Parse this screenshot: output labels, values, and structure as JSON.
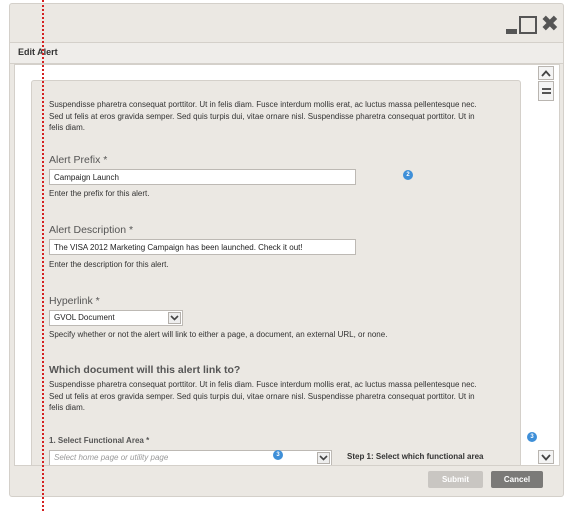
{
  "window": {
    "title": "Edit Alert",
    "controls": [
      "minimize-icon",
      "maximize-icon",
      "close-icon"
    ]
  },
  "form": {
    "intro": "Suspendisse pharetra consequat porttitor. Ut in felis diam. Fusce interdum mollis erat, ac luctus massa pellentesque nec. Sed ut felis at eros gravida semper. Sed quis turpis dui, vitae ornare nisl. Suspendisse pharetra consequat porttitor. Ut in felis diam.",
    "alert_prefix": {
      "label": "Alert Prefix *",
      "value": "Campaign Launch",
      "help": "Enter the prefix for this alert.",
      "badge": "2"
    },
    "alert_description": {
      "label": "Alert Description *",
      "value": "The VISA 2012 Marketing Campaign has been launched.  Check it out!",
      "help": "Enter the description for this alert."
    },
    "hyperlink": {
      "label": "Hyperlink *",
      "selected": "GVOL Document",
      "help": "Specify whether or not the alert will link to either a page, a document, an external URL, or none."
    },
    "document_section": {
      "heading": "Which document will this alert link to?",
      "description": "Suspendisse pharetra consequat porttitor. Ut in felis diam. Fusce interdum mollis erat, ac luctus massa pellentesque nec. Sed ut felis at eros gravida semper. Sed quis turpis dui, vitae ornare nisl. Suspendisse pharetra consequat porttitor. Ut in felis diam."
    },
    "functional_area": {
      "label": "1. Select Functional Area *",
      "placeholder": "Select home page or utility page",
      "badge": "3",
      "step_text": "Step 1: Select which functional area"
    },
    "side_badge": "3"
  },
  "buttons": {
    "submit": "Submit",
    "cancel": "Cancel"
  },
  "colors": {
    "badge": "#3e8fd8",
    "cancel_button": "#7b7a78",
    "submit_button_disabled": "#c9c6c2",
    "annotation_line": "#d42020"
  }
}
